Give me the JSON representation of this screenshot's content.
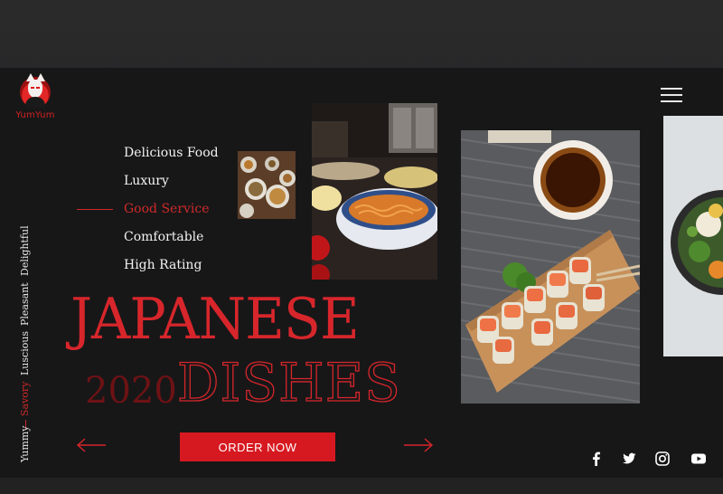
{
  "brand": {
    "name": "YumYum"
  },
  "vertical_nav": {
    "items": [
      {
        "label": "Delightful",
        "active": false
      },
      {
        "label": "Pleasant",
        "active": false
      },
      {
        "label": "Luscious",
        "active": false
      },
      {
        "label": "Savory",
        "active": true
      },
      {
        "label": "Yummy",
        "active": false
      }
    ]
  },
  "features": {
    "items": [
      {
        "label": "Delicious Food",
        "active": false
      },
      {
        "label": "Luxury",
        "active": false
      },
      {
        "label": "Good Service",
        "active": true
      },
      {
        "label": "Comfortable",
        "active": false
      },
      {
        "label": "High Rating",
        "active": false
      }
    ]
  },
  "hero": {
    "line1": "JAPANESE",
    "year": "2020",
    "line2": "DISHES"
  },
  "cta": {
    "label": "ORDER NOW"
  },
  "colors": {
    "accent": "#d7262b",
    "background": "#171718",
    "text": "#f3f3f3"
  },
  "icons": {
    "menu": "hamburger-icon",
    "prev": "arrow-left-icon",
    "next": "arrow-right-icon",
    "social": [
      "facebook-icon",
      "twitter-icon",
      "instagram-icon",
      "youtube-icon"
    ]
  }
}
